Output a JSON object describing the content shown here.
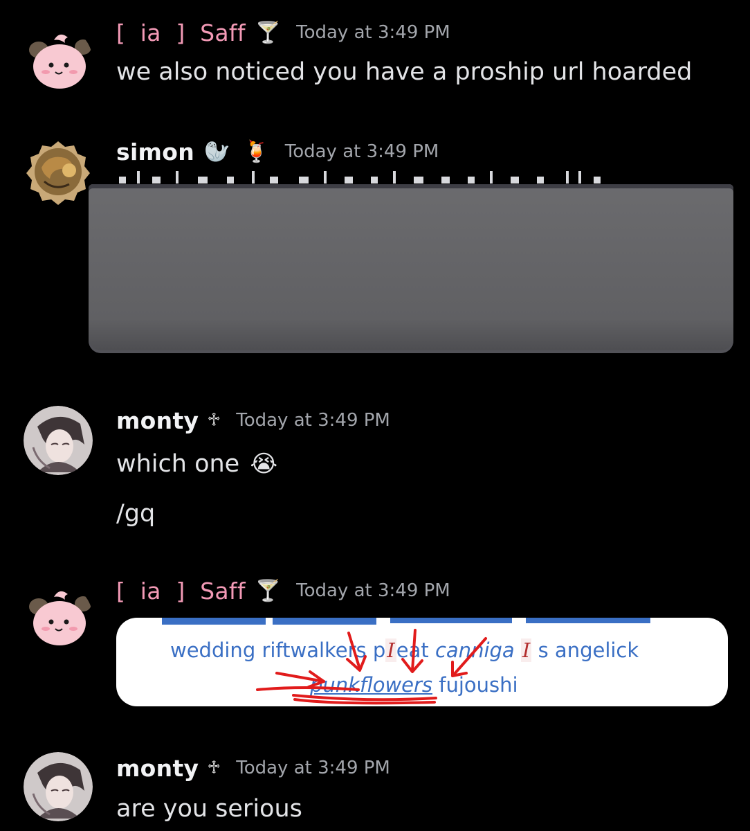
{
  "messages": [
    {
      "author_bracket_open": "[",
      "author_tag": "ia",
      "author_bracket_close": "]",
      "author_name": "Saff",
      "author_emoji": "🍸",
      "timestamp": "Today at 3:49 PM",
      "lines": [
        "we also noticed you have a proship url hoarded"
      ]
    },
    {
      "author_name": "simon",
      "author_emoji_1": "🦭",
      "author_emoji_2": "🍹",
      "timestamp": "Today at 3:49 PM"
    },
    {
      "author_name": "monty",
      "author_emoji": "♱",
      "timestamp": "Today at 3:49 PM",
      "lines": [
        "which one",
        "/gq"
      ],
      "inline_emoji": "😭"
    },
    {
      "author_bracket_open": "[",
      "author_tag": "ia",
      "author_bracket_close": "]",
      "author_name": "Saff",
      "author_emoji": "🍸",
      "timestamp": "Today at 3:49 PM",
      "attachment": {
        "line2_a": "wedding riftwalkers p",
        "line2_mark1": "I",
        "line2_b": "eat",
        "line2_italic": "canniga",
        "line2_mark2": "I",
        "line2_c": "s angelick",
        "line3_highlight": "punkflowers",
        "line3_rest": "fujoushi"
      }
    },
    {
      "author_name": "monty",
      "author_emoji": "♱",
      "timestamp": "Today at 3:49 PM",
      "lines": [
        "are you serious"
      ]
    }
  ],
  "colors": {
    "background": "#000000",
    "pink_author": "#f39ab6",
    "timestamp": "#a3a6ac",
    "link_blue": "#3a6fc4",
    "annotation_red": "#e11b1b"
  }
}
